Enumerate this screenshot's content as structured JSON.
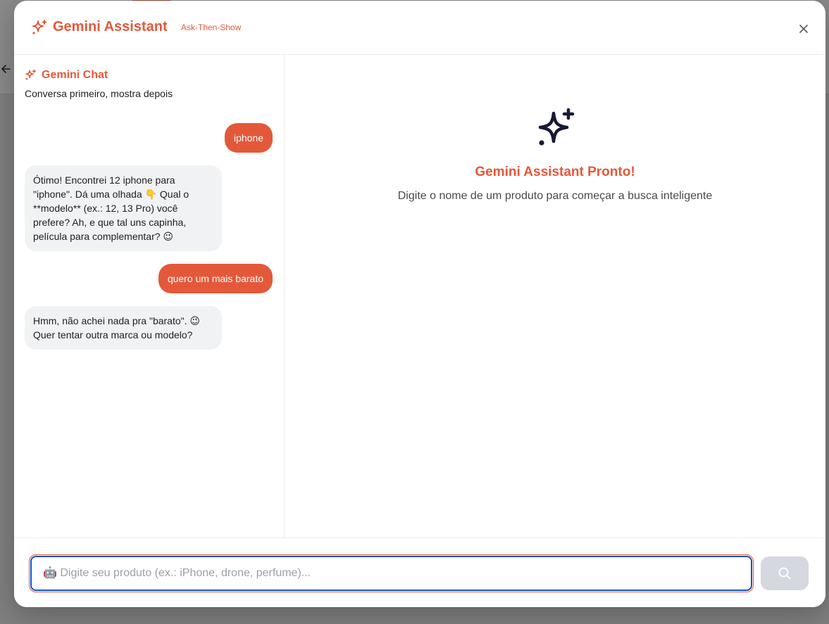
{
  "header": {
    "title": "Gemini Assistant",
    "subtitle": "Ask-Then-Show",
    "icon": "sparkles-icon",
    "close_icon": "close-icon"
  },
  "chat": {
    "title": "Gemini Chat",
    "subtitle": "Conversa primeiro, mostra depois",
    "messages": [
      {
        "role": "user",
        "text": "iphone"
      },
      {
        "role": "bot",
        "text": "Ótimo! Encontrei 12 iphone para \"iphone\". Dá uma olhada 👇 Qual o **modelo** (ex.: 12, 13 Pro) você prefere? Ah, e que tal uns capinha, película para complementar? 😉"
      },
      {
        "role": "user",
        "text": "quero um mais barato"
      },
      {
        "role": "bot",
        "text": "Hmm, não achei nada pra \"barato\". 😉 Quer tentar outra marca ou modelo?"
      }
    ]
  },
  "result": {
    "title": "Gemini Assistant Pronto!",
    "subtitle": "Digite o nome de um produto para começar a busca inteligente",
    "icon": "sparkles-icon"
  },
  "search": {
    "placeholder": "🤖 Digite seu produto (ex.: iPhone, drone, perfume)...",
    "value": "",
    "button_icon": "search-icon"
  },
  "colors": {
    "accent": "#e4583a",
    "focus_ring": "#1e4fb8",
    "bot_bubble": "#f1f2f4",
    "button_disabled": "#d5d8de"
  }
}
